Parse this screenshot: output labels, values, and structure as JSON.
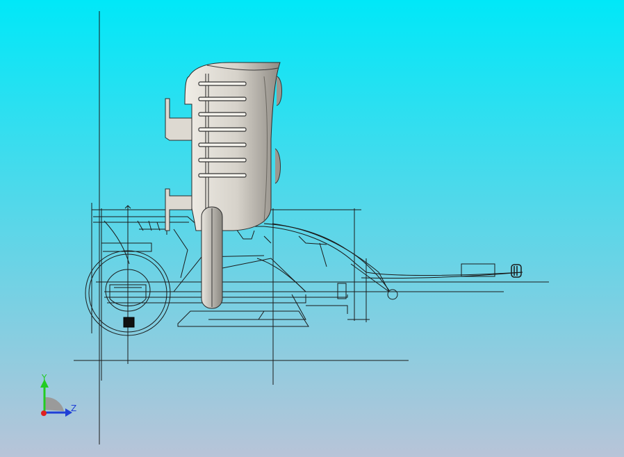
{
  "viewport": {
    "background_top": "#00E8F8",
    "background_bottom": "#B8C4D8",
    "wire_color": "#1a1a1a",
    "body_fill": "#d8d4cc",
    "body_shade": "#8e8a82"
  },
  "triad": {
    "y_label": "Y",
    "z_label": "Z",
    "y_color": "#22cc22",
    "z_color": "#1f3fd6",
    "x_color": "#e02020"
  }
}
